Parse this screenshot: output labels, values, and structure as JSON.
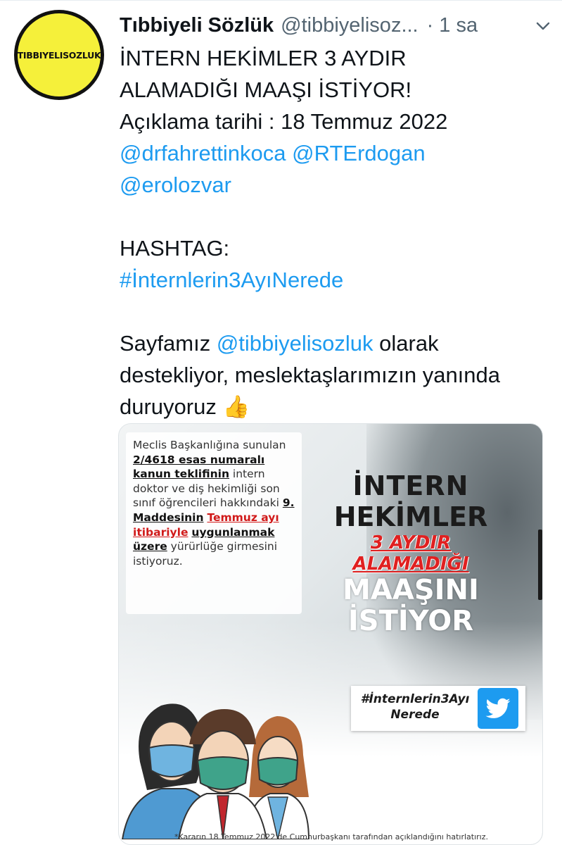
{
  "tweet": {
    "avatar_text": "TIBBIYELISOZLUK",
    "display_name": "Tıbbiyeli Sözlük",
    "handle": "@tibbiyelisoz...",
    "separator": "·",
    "time": "1 sa",
    "lines": {
      "title_1": "İNTERN HEKİMLER 3 AYDIR",
      "title_2": "ALAMADIĞI MAAŞI İSTİYOR!",
      "date_line": "Açıklama tarihi : 18 Temmuz 2022",
      "mention_1": "@drfahrettinkoca",
      "mention_2": "@RTErdogan",
      "mention_3": "@erolozvar",
      "hashtag_label": "HASHTAG:",
      "hashtag": "#İnternlerin3AyıNerede",
      "support_1a": "Sayfamız ",
      "support_mention": "@tibbiyelisozluk",
      "support_1b": " olarak",
      "support_2": "destekliyor, meslektaşlarımızın yanında",
      "support_3": "duruyoruz 👍"
    }
  },
  "media": {
    "info": {
      "p1": "Meclis Başkanlığına sunulan ",
      "p2": "2/4618 esas numaralı kanun teklifinin",
      "p3": " intern doktor ve diş hekimliği son sınıf öğrencileri hakkındaki ",
      "p4": "9. Maddesinin",
      "p5": " ",
      "p6": "Temmuz ayı itibariyle",
      "p7": " ",
      "p8": "uygunlanmak üzere",
      "p9": " yürürlüğe girmesini istiyoruz."
    },
    "headline": {
      "l1": "İNTERN",
      "l2": "HEKİMLER",
      "l3": "3 AYDIR",
      "l4": "ALAMADIĞI",
      "l5": "MAAŞINI",
      "l6": "İSTİYOR"
    },
    "hashtag_card": {
      "line1": "#İnternlerin3Ayı",
      "line2": "Nerede"
    },
    "caption": "*Kararın 18 Temmuz 2022'de Cumhurbaşkanı tarafından açıklandığını hatırlatırız."
  },
  "colors": {
    "link": "#1d9bf0",
    "red": "#e02020",
    "avatar_yellow": "#f5f03a",
    "mask_blue": "#6fb4e0",
    "mask_green": "#3fa38a"
  }
}
